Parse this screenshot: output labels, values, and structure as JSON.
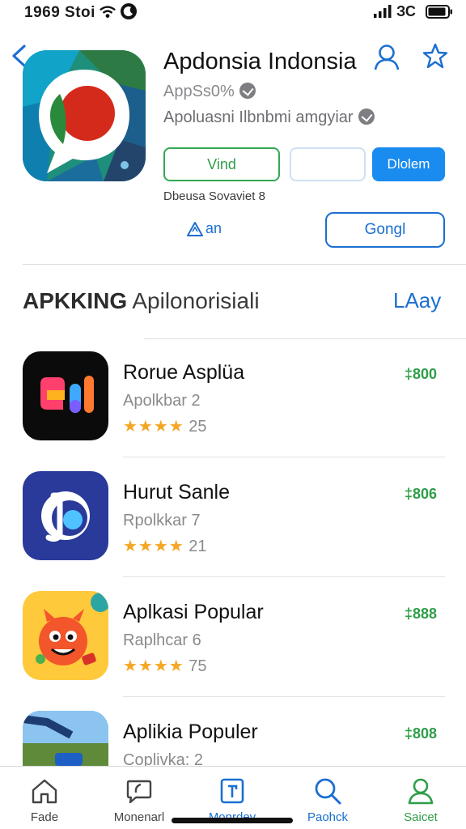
{
  "status_bar": {
    "time": "1969 Stoi",
    "network": "ЗС"
  },
  "app": {
    "title": "Apdonsia Indonsia",
    "subtitle": "AppSs0%",
    "subtitle2": "Apoluasni Ilbnbmi amgyiar",
    "btn_primary": "Vind",
    "btn_secondary": "",
    "btn_download": "Dlolem",
    "developer": "Dbeusa Sovaviet 8",
    "warn_link": "an",
    "btn_outline": "Gongl"
  },
  "section": {
    "title_bold": "APKKING",
    "title_rest": "Apilonorisiali",
    "link": "LAay"
  },
  "list": [
    {
      "name": "Rorue Asplüa",
      "category": "Apolkbar 2",
      "stars": "★★★★",
      "rating": "25",
      "price": "‡800"
    },
    {
      "name": "Hurut Sanle",
      "category": "Rpolkkar 7",
      "stars": "★★★★",
      "rating": "21",
      "price": "‡806"
    },
    {
      "name": "Aplkasi Popular",
      "category": "Raplhcar 6",
      "stars": "★★★★",
      "rating": "75",
      "price": "‡888"
    },
    {
      "name": "Aplikia Populer",
      "category": "Coplivka: 2",
      "stars": "",
      "rating": "",
      "price": "‡808"
    }
  ],
  "tabbar": [
    {
      "label": "Fade",
      "icon": "home-icon",
      "color": "#444444"
    },
    {
      "label": "Monenarl",
      "icon": "chat-icon",
      "color": "#444444"
    },
    {
      "label": "Monrdev",
      "icon": "apps-icon",
      "color": "#1b6fd1"
    },
    {
      "label": "Paohck",
      "icon": "search-icon",
      "color": "#1b6fd1"
    },
    {
      "label": "Saicet",
      "icon": "person-icon",
      "color": "#2f9e48"
    }
  ],
  "colors": {
    "accent": "#1b6fd1",
    "green": "#2f9e48",
    "star": "#f5a623"
  }
}
